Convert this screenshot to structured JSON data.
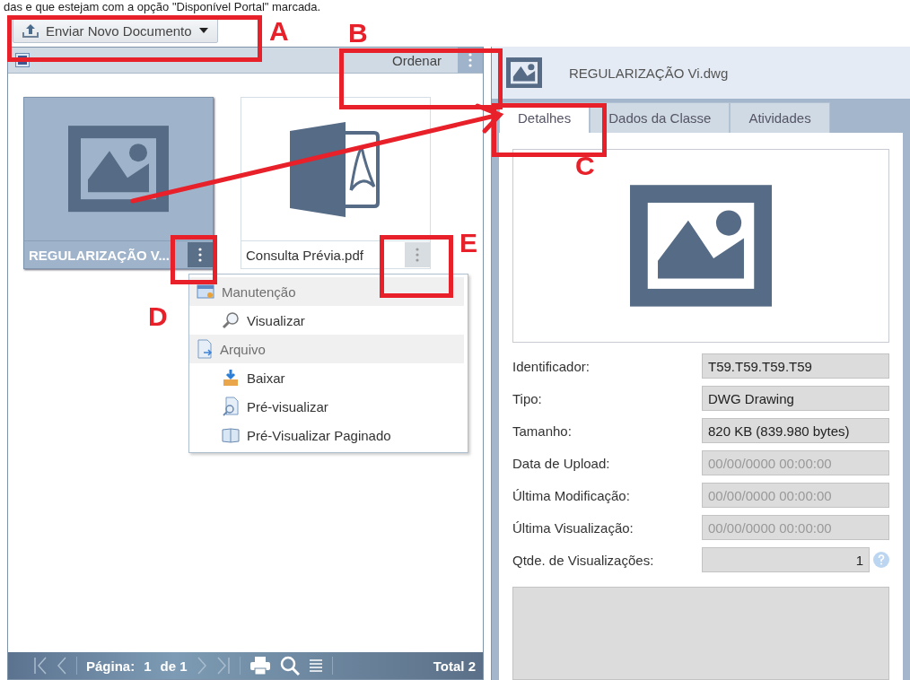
{
  "caption": "das e que estejam com a opção \"Disponível Portal\" marcada.",
  "upload_button": {
    "label": "Enviar Novo Documento"
  },
  "list_toolbar": {
    "sort_button": "Ordenar"
  },
  "documents": [
    {
      "name": "REGULARIZAÇÃO V...",
      "kind": "image",
      "selected": true
    },
    {
      "name": "Consulta Prévia.pdf",
      "kind": "pdf",
      "selected": false
    }
  ],
  "context_menu": [
    {
      "kind": "group",
      "label": "Manutenção"
    },
    {
      "kind": "item",
      "label": "Visualizar"
    },
    {
      "kind": "group",
      "label": "Arquivo"
    },
    {
      "kind": "item",
      "label": "Baixar"
    },
    {
      "kind": "item",
      "label": "Pré-visualizar"
    },
    {
      "kind": "item",
      "label": "Pré-Visualizar Paginado"
    }
  ],
  "pager": {
    "page_label": "Página:",
    "page": "1",
    "of": "de 1",
    "total": "Total 2"
  },
  "details": {
    "title": "REGULARIZAÇÃO Vi.dwg",
    "tabs": [
      {
        "label": "Detalhes",
        "selected": true
      },
      {
        "label": "Dados da Classe",
        "selected": false
      },
      {
        "label": "Atividades",
        "selected": false
      }
    ],
    "fields": [
      {
        "label": "Identificador:",
        "value": "T59.T59.T59.T59",
        "disabled": false,
        "kind": "text"
      },
      {
        "label": "Tipo:",
        "value": "DWG Drawing",
        "disabled": false,
        "kind": "text"
      },
      {
        "label": "Tamanho:",
        "value": "820 KB (839.980 bytes)",
        "disabled": false,
        "kind": "text"
      },
      {
        "label": "Data de Upload:",
        "value": "00/00/0000 00:00:00",
        "disabled": true,
        "kind": "text"
      },
      {
        "label": "Última Modificação:",
        "value": "00/00/0000 00:00:00",
        "disabled": true,
        "kind": "text"
      },
      {
        "label": "Última Visualização:",
        "value": "00/00/0000 00:00:00",
        "disabled": true,
        "kind": "text"
      },
      {
        "label": "Qtde. de Visualizações:",
        "value": "1",
        "disabled": false,
        "kind": "number"
      }
    ]
  },
  "annotations": [
    "A",
    "B",
    "C",
    "D",
    "E"
  ]
}
